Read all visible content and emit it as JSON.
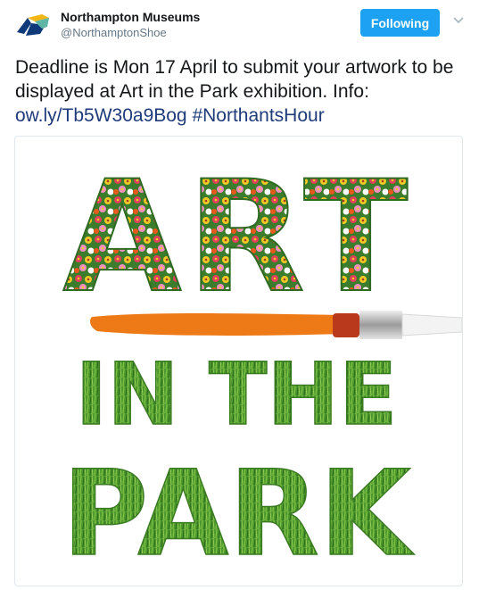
{
  "account": {
    "name": "Northampton Museums",
    "handle": "@NorthamptonShoe",
    "avatar_icon": "museum-logo-icon"
  },
  "follow_button": {
    "label": "Following"
  },
  "menu": {
    "icon": "chevron-down-icon"
  },
  "tweet": {
    "text_before": "Deadline is Mon 17 April to submit your artwork to be displayed at Art in the Park exhibition. Info: ",
    "link": "ow.ly/Tb5W30a9Bog",
    "space": " ",
    "hashtag": "#NorthantsHour"
  },
  "image": {
    "word_top": "ART",
    "word_middle": "IN THE",
    "word_bottom": "PARK",
    "colors": {
      "flowers": "#e0405a",
      "grass": "#3f8f2a",
      "paint": "#ed7a17",
      "brush_tip": "#b8391b"
    }
  }
}
